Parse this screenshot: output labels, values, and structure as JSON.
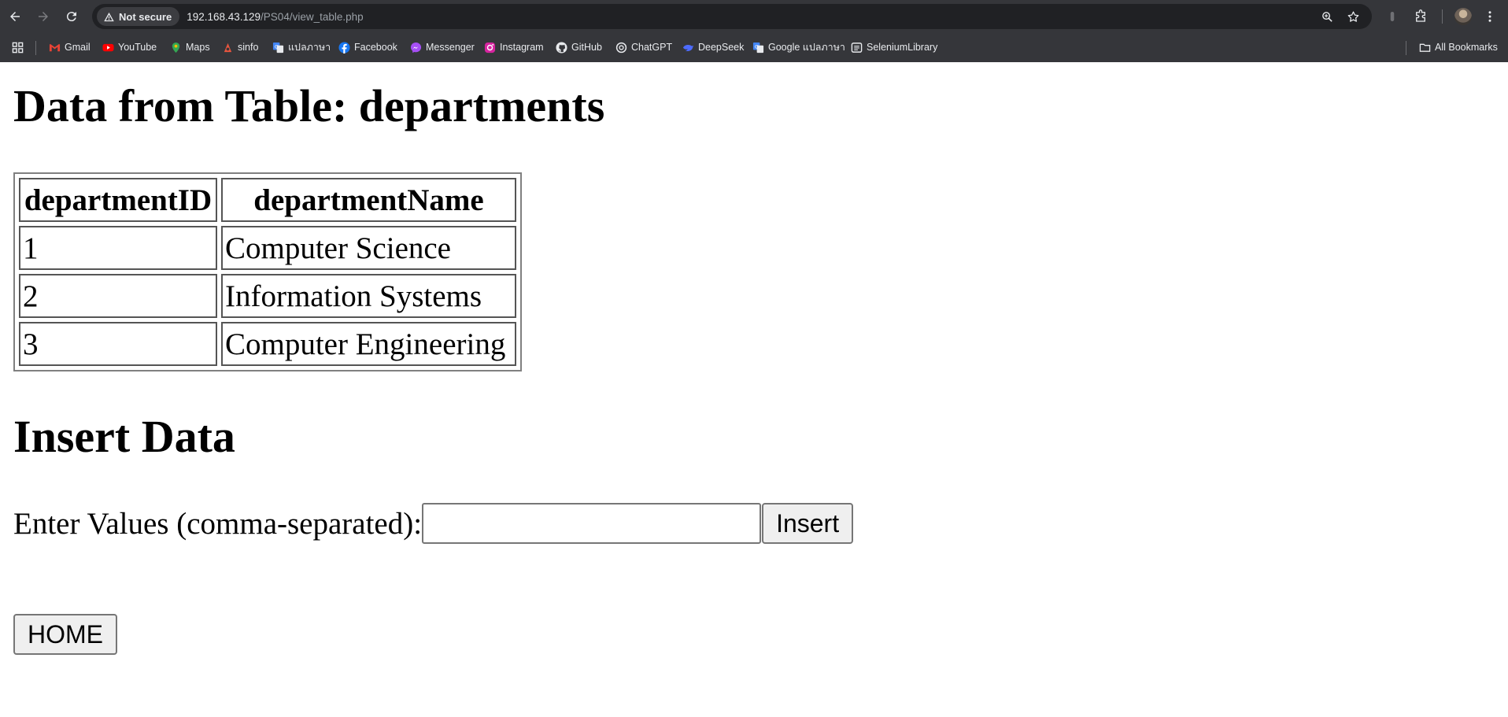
{
  "browser": {
    "security_label": "Not secure",
    "url_host": "192.168.43.129",
    "url_path": "/PS04/view_table.php",
    "bookmarks": [
      {
        "label": "Gmail",
        "icon": "gmail-icon"
      },
      {
        "label": "YouTube",
        "icon": "youtube-icon"
      },
      {
        "label": "Maps",
        "icon": "maps-icon"
      },
      {
        "label": "sinfo",
        "icon": "sinfo-icon"
      },
      {
        "label": "แปลภาษา",
        "icon": "translate-icon"
      },
      {
        "label": "Facebook",
        "icon": "facebook-icon"
      },
      {
        "label": "Messenger",
        "icon": "messenger-icon"
      },
      {
        "label": "Instagram",
        "icon": "instagram-icon"
      },
      {
        "label": "GitHub",
        "icon": "github-icon"
      },
      {
        "label": "ChatGPT",
        "icon": "chatgpt-icon"
      },
      {
        "label": "DeepSeek",
        "icon": "deepseek-icon"
      },
      {
        "label": "Google แปลภาษา",
        "icon": "translate-icon"
      },
      {
        "label": "SeleniumLibrary",
        "icon": "selenium-icon"
      }
    ],
    "all_bookmarks_label": "All Bookmarks",
    "colors": {
      "chrome_bg": "#35363a",
      "omnibox_bg": "#202124",
      "text": "#e8eaed"
    }
  },
  "page": {
    "title": "Data from Table: departments",
    "table": {
      "headers": [
        "departmentID",
        "departmentName"
      ],
      "rows": [
        [
          "1",
          "Computer Science"
        ],
        [
          "2",
          "Information Systems"
        ],
        [
          "3",
          "Computer Engineering"
        ]
      ]
    },
    "insert_heading": "Insert Data",
    "insert_label": "Enter Values (comma-separated):",
    "insert_value": "",
    "insert_button": "Insert",
    "home_button": "HOME"
  }
}
